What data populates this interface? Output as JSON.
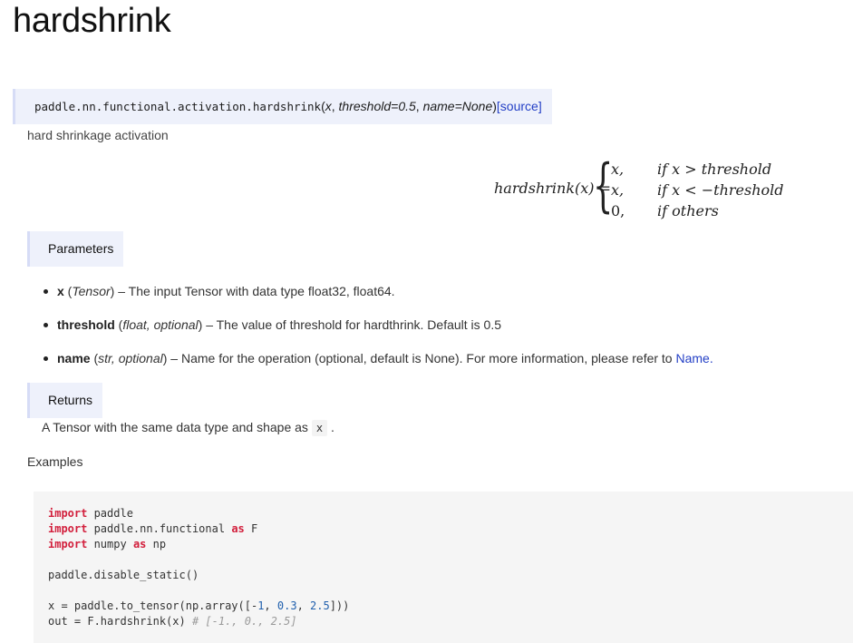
{
  "page_title": "hardshrink",
  "signature": {
    "module_path": "paddle.nn.functional.activation.",
    "func_name": "hardshrink",
    "open_paren": "(",
    "arg_x": "x",
    "sep1": ", ",
    "arg_threshold": "threshold=0.5",
    "sep2": ", ",
    "arg_name": "name=None",
    "close_paren": ")",
    "source_link": "[source]"
  },
  "description": "hard shrinkage activation",
  "formula": {
    "lhs": "hardshrink(x) =",
    "brace": "{",
    "cases": [
      {
        "value": "x,",
        "condition": "if x > threshold"
      },
      {
        "value": "x,",
        "condition": "if x < −threshold"
      },
      {
        "value": "0,",
        "condition": "if others"
      }
    ]
  },
  "parameters": {
    "heading": "Parameters",
    "items": [
      {
        "name": "x",
        "type_open": " (",
        "type": "Tensor",
        "type_close": ")",
        "desc": " – The input Tensor with data type float32, float64."
      },
      {
        "name": "threshold",
        "type_open": " (",
        "type": "float, optional",
        "type_close": ")",
        "desc": " – The value of threshold for hardthrink. Default is 0.5"
      },
      {
        "name": "name",
        "type_open": " (",
        "type": "str, optional",
        "type_close": ")",
        "desc": " – Name for the operation (optional, default is None). For more information, please refer to ",
        "link": "Name",
        "after": "."
      }
    ]
  },
  "returns": {
    "heading": "Returns",
    "text_before": "A Tensor with the same data type and shape as ",
    "code": "x",
    "text_after": " ."
  },
  "examples": {
    "heading": "Examples",
    "code_lines": [
      [
        {
          "t": "import",
          "c": "kw"
        },
        {
          "t": " paddle",
          "c": ""
        }
      ],
      [
        {
          "t": "import",
          "c": "kw"
        },
        {
          "t": " paddle.nn.functional ",
          "c": ""
        },
        {
          "t": "as",
          "c": "kw"
        },
        {
          "t": " F",
          "c": ""
        }
      ],
      [
        {
          "t": "import",
          "c": "kw"
        },
        {
          "t": " numpy ",
          "c": ""
        },
        {
          "t": "as",
          "c": "kw"
        },
        {
          "t": " np",
          "c": ""
        }
      ],
      [],
      [
        {
          "t": "paddle.disable_static()",
          "c": ""
        }
      ],
      [],
      [
        {
          "t": "x = paddle.to_tensor(np.array([-",
          "c": ""
        },
        {
          "t": "1",
          "c": "num"
        },
        {
          "t": ", ",
          "c": ""
        },
        {
          "t": "0.3",
          "c": "num"
        },
        {
          "t": ", ",
          "c": ""
        },
        {
          "t": "2.5",
          "c": "num"
        },
        {
          "t": "]))",
          "c": ""
        }
      ],
      [
        {
          "t": "out = F.hardshrink(x) ",
          "c": ""
        },
        {
          "t": "# [-1., 0., 2.5]",
          "c": "cmt"
        }
      ]
    ]
  }
}
